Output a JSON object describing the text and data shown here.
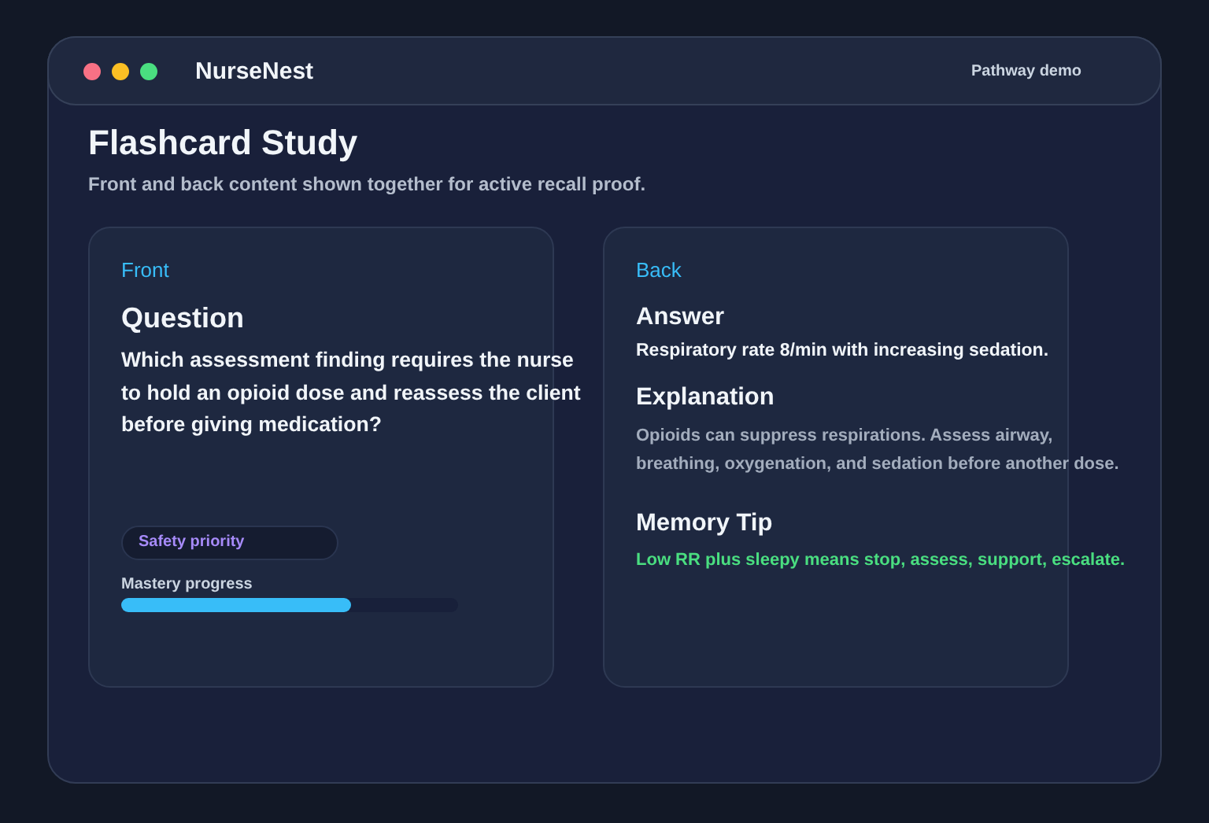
{
  "app": {
    "name": "NurseNest",
    "badge": "Pathway demo"
  },
  "page": {
    "title": "Flashcard Study",
    "subtitle": "Front and back content shown together for active recall proof."
  },
  "front": {
    "side": "Front",
    "heading": "Question",
    "text": "Which assessment finding requires the nurse to hold an opioid dose and reassess the client before giving medication?",
    "tag": "Safety priority",
    "progress": {
      "label": "Mastery progress",
      "level": 0.68
    }
  },
  "back": {
    "side": "Back",
    "sections": [
      {
        "kind": "answer",
        "heading": "Answer",
        "text": "Respiratory rate 8/min with increasing sedation."
      },
      {
        "kind": "explanation",
        "heading": "Explanation",
        "text": "Opioids can suppress respirations. Assess airway, breathing, oxygenation, and sedation before another dose."
      },
      {
        "kind": "tip",
        "heading": "Memory Tip",
        "text": "Low RR plus sleepy means stop, assess, support, escalate."
      }
    ]
  }
}
